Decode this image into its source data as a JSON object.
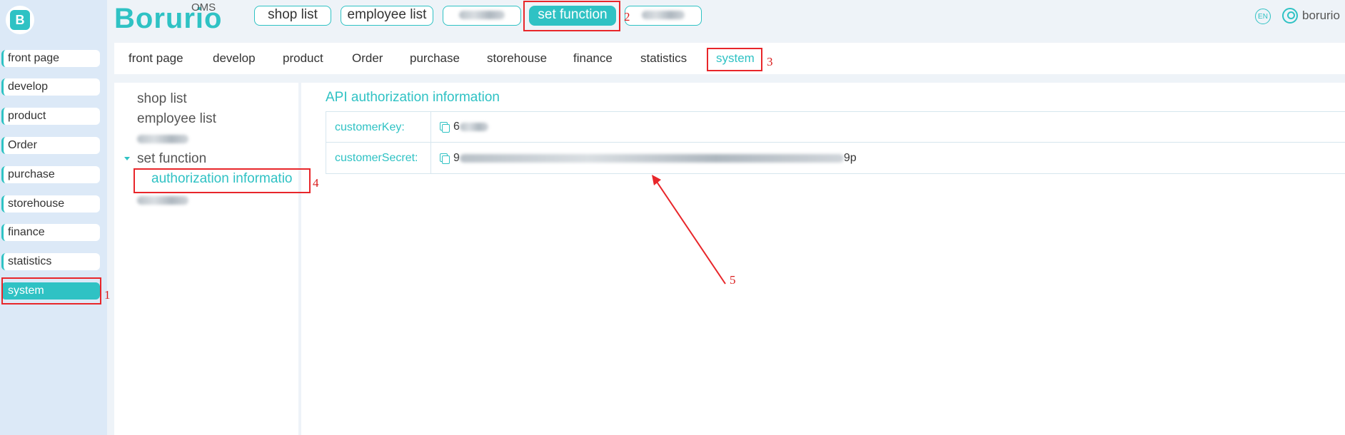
{
  "brand": {
    "name": "Borurio",
    "suffix": "OMS"
  },
  "header": {
    "buttons": [
      {
        "label": "shop list"
      },
      {
        "label": "employee list"
      },
      {
        "label": ""
      },
      {
        "label": "set function"
      },
      {
        "label": ""
      }
    ],
    "language": "EN",
    "username": "borurio"
  },
  "sidebar": {
    "items": [
      {
        "label": "front page"
      },
      {
        "label": "develop"
      },
      {
        "label": "product"
      },
      {
        "label": "Order"
      },
      {
        "label": "purchase"
      },
      {
        "label": "storehouse"
      },
      {
        "label": "finance"
      },
      {
        "label": "statistics"
      },
      {
        "label": "system"
      }
    ]
  },
  "tabs": {
    "items": [
      {
        "label": "front page"
      },
      {
        "label": "develop"
      },
      {
        "label": "product"
      },
      {
        "label": "Order"
      },
      {
        "label": "purchase"
      },
      {
        "label": "storehouse"
      },
      {
        "label": "finance"
      },
      {
        "label": "statistics"
      },
      {
        "label": "system"
      }
    ]
  },
  "subnav": {
    "items": [
      {
        "label": "shop list"
      },
      {
        "label": "employee list"
      },
      {
        "label": ""
      },
      {
        "label": "set function"
      },
      {
        "label": "authorization informatio"
      },
      {
        "label": ""
      }
    ]
  },
  "main": {
    "title": "API authorization information",
    "rows": [
      {
        "key": "customerKey:",
        "value_start": "6",
        "value_end": ""
      },
      {
        "key": "customerSecret:",
        "value_start": "9",
        "value_end": "9p"
      }
    ]
  },
  "annotations": [
    "1",
    "2",
    "3",
    "4",
    "5"
  ],
  "colors": {
    "accent": "#2fc2c4",
    "annotation": "#e8262a"
  }
}
